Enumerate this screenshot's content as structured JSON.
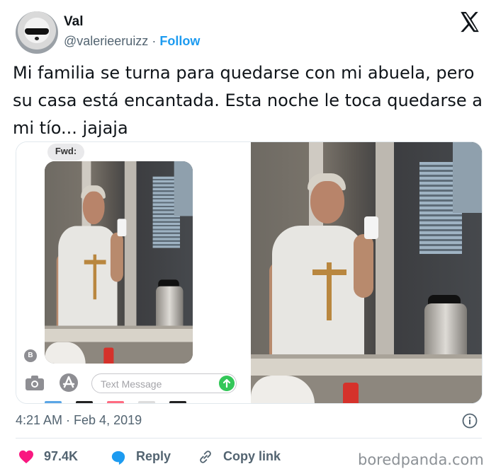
{
  "author": {
    "name": "Val",
    "handle": "@valerieeruizz",
    "separator": "·",
    "follow_label": "Follow"
  },
  "tweet": {
    "text": "Mi familia se turna para quedarse con mi abuela, pero su casa está encantada. Esta noche le toca quedarse a mi tío... jajaja",
    "timestamp": "4:21 AM · Feb 4, 2019"
  },
  "media": {
    "messages_screenshot": {
      "fwd_label": "Fwd:",
      "sender_initial": "B",
      "input_placeholder": "Text Message"
    }
  },
  "actions": {
    "likes": "97.4K",
    "reply_label": "Reply",
    "copy_link_label": "Copy link"
  },
  "watermark": "boredpanda.com",
  "colors": {
    "accent": "#1d9bf0",
    "like": "#f91880",
    "muted": "#536471",
    "send": "#34c759"
  },
  "icons": [
    "x-logo-icon",
    "info-icon",
    "heart-icon",
    "reply-icon",
    "link-icon",
    "camera-icon",
    "app-store-icon",
    "send-arrow-icon"
  ]
}
